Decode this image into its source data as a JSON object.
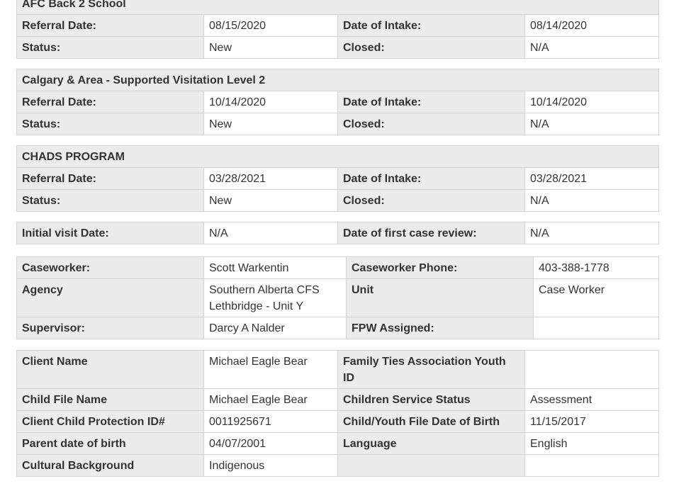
{
  "programs": [
    {
      "name": "AFC Back 2 School",
      "referral_label": "Referral Date:",
      "referral_date": "08/15/2020",
      "intake_label": "Date of Intake:",
      "intake_date": "08/14/2020",
      "status_label": "Status:",
      "status": "New",
      "closed_label": "Closed:",
      "closed": "N/A"
    },
    {
      "name": "Calgary & Area - Supported Visitation Level 2",
      "referral_label": "Referral Date:",
      "referral_date": "10/14/2020",
      "intake_label": "Date of Intake:",
      "intake_date": "10/14/2020",
      "status_label": "Status:",
      "status": "New",
      "closed_label": "Closed:",
      "closed": "N/A"
    },
    {
      "name": "CHADS PROGRAM",
      "referral_label": "Referral Date:",
      "referral_date": "03/28/2021",
      "intake_label": "Date of Intake:",
      "intake_date": "03/28/2021",
      "status_label": "Status:",
      "status": "New",
      "closed_label": "Closed:",
      "closed": "N/A"
    }
  ],
  "visit": {
    "initial_label": "Initial visit Date:",
    "initial_value": "N/A",
    "review_label": "Date of first case review:",
    "review_value": "N/A"
  },
  "caseworker": {
    "caseworker_label": "Caseworker:",
    "caseworker_value": "Scott Warkentin",
    "phone_label": "Caseworker Phone:",
    "phone_value": "403-388-1778",
    "agency_label": "Agency",
    "agency_line1": "Southern Alberta CFS",
    "agency_line2": "Lethbridge - Unit Y",
    "unit_label": "Unit",
    "unit_value": "Case Worker",
    "supervisor_label": "Supervisor:",
    "supervisor_value": "Darcy A Nalder",
    "fpw_label": "FPW Assigned:",
    "fpw_value": ""
  },
  "client": {
    "client_name_label": "Client Name",
    "client_name_value": "Michael Eagle Bear",
    "fta_id_label": "Family Ties Association Youth ID",
    "fta_id_value": "",
    "child_file_label": "Child File Name",
    "child_file_value": "Michael Eagle Bear",
    "service_status_label": "Children Service Status",
    "service_status_value": "Assessment",
    "protection_id_label": "Client Child Protection ID#",
    "protection_id_value": "0011925671",
    "dob_label": "Child/Youth File Date of Birth",
    "dob_value": "11/15/2017",
    "parent_dob_label": "Parent date of birth",
    "parent_dob_value": "04/07/2001",
    "language_label": "Language",
    "language_value": "English",
    "cultural_label": "Cultural Background",
    "cultural_value": "Indigenous"
  }
}
